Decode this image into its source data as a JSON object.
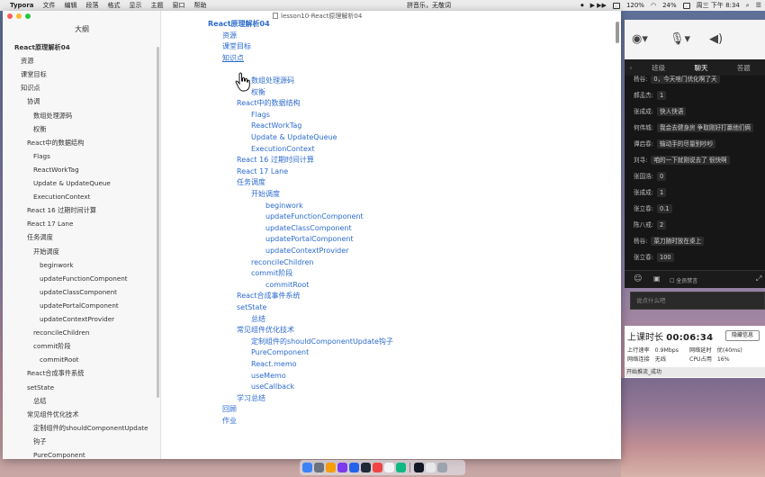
{
  "menubar": {
    "app": "Typora",
    "items": [
      "文件",
      "编辑",
      "段落",
      "格式",
      "显示",
      "主题",
      "窗口",
      "帮助"
    ],
    "banner": "拼音乐，无敬词",
    "zoom": "120%",
    "battery": "24%",
    "clock": "周三 下午 8:34"
  },
  "window": {
    "title": "lesson10-React原理解析04"
  },
  "sidebar": {
    "title": "大纲",
    "items": [
      {
        "label": "React原理解析04",
        "level": 0,
        "bold": true
      },
      {
        "label": "资源",
        "level": 1
      },
      {
        "label": "课堂目标",
        "level": 1
      },
      {
        "label": "知识点",
        "level": 1
      },
      {
        "label": "协调",
        "level": 2
      },
      {
        "label": "数组处理源码",
        "level": 3
      },
      {
        "label": "权衡",
        "level": 3
      },
      {
        "label": "React中的数据结构",
        "level": 2
      },
      {
        "label": "Flags",
        "level": 3
      },
      {
        "label": "ReactWorkTag",
        "level": 3
      },
      {
        "label": "Update & UpdateQueue",
        "level": 3
      },
      {
        "label": "ExecutionContext",
        "level": 3
      },
      {
        "label": "React 16 过期时间计算",
        "level": 2
      },
      {
        "label": "React 17 Lane",
        "level": 2
      },
      {
        "label": "任务调度",
        "level": 2
      },
      {
        "label": "开始调度",
        "level": 3
      },
      {
        "label": "beginwork",
        "level": 4
      },
      {
        "label": "updateFunctionComponent",
        "level": 4
      },
      {
        "label": "updateClassComponent",
        "level": 4
      },
      {
        "label": "updatePortalComponent",
        "level": 4
      },
      {
        "label": "updateContextProvider",
        "level": 4
      },
      {
        "label": "reconcileChildren",
        "level": 3
      },
      {
        "label": "commit阶段",
        "level": 3
      },
      {
        "label": "commitRoot",
        "level": 4
      },
      {
        "label": "React合成事件系统",
        "level": 2
      },
      {
        "label": "setState",
        "level": 2
      },
      {
        "label": "总结",
        "level": 3
      },
      {
        "label": "常见组件优化技术",
        "level": 2
      },
      {
        "label": "定制组件的shouldComponentUpdate",
        "level": 3
      },
      {
        "label": "钩子",
        "level": 3,
        "continuation": true
      },
      {
        "label": "PureComponent",
        "level": 3
      }
    ]
  },
  "document": {
    "toc": [
      {
        "label": "React原理解析04",
        "level": 0,
        "bold": true
      },
      {
        "label": "资源",
        "level": 1
      },
      {
        "label": "课堂目标",
        "level": 1
      },
      {
        "label": "知识点",
        "level": 1,
        "hover": true
      },
      {
        "label": "",
        "level": 2
      },
      {
        "label": "数组处理源码",
        "level": 3
      },
      {
        "label": "权衡",
        "level": 3
      },
      {
        "label": "React中的数据结构",
        "level": 2
      },
      {
        "label": "Flags",
        "level": 3
      },
      {
        "label": "ReactWorkTag",
        "level": 3
      },
      {
        "label": "Update & UpdateQueue",
        "level": 3
      },
      {
        "label": "ExecutionContext",
        "level": 3
      },
      {
        "label": "React 16 过期时间计算",
        "level": 2
      },
      {
        "label": "React 17 Lane",
        "level": 2
      },
      {
        "label": "任务调度",
        "level": 2
      },
      {
        "label": "开始调度",
        "level": 3
      },
      {
        "label": "beginwork",
        "level": 4
      },
      {
        "label": "updateFunctionComponent",
        "level": 4
      },
      {
        "label": "updateClassComponent",
        "level": 4
      },
      {
        "label": "updatePortalComponent",
        "level": 4
      },
      {
        "label": "updateContextProvider",
        "level": 4
      },
      {
        "label": "reconcileChildren",
        "level": 3
      },
      {
        "label": "commit阶段",
        "level": 3
      },
      {
        "label": "commitRoot",
        "level": 4
      },
      {
        "label": "React合成事件系统",
        "level": 2
      },
      {
        "label": "setState",
        "level": 2
      },
      {
        "label": "总结",
        "level": 3
      },
      {
        "label": "常见组件优化技术",
        "level": 2
      },
      {
        "label": "定制组件的shouldComponentUpdate钩子",
        "level": 3
      },
      {
        "label": "PureComponent",
        "level": 3
      },
      {
        "label": "React.memo",
        "level": 3
      },
      {
        "label": "useMemo",
        "level": 3
      },
      {
        "label": "useCallback",
        "level": 3
      },
      {
        "label": "学习总结",
        "level": 2
      },
      {
        "label": "回顾",
        "level": 1
      },
      {
        "label": "作业",
        "level": 1
      }
    ]
  },
  "classroom": {
    "tabs": [
      "班级",
      "聊天",
      "答题"
    ],
    "active_tab": "聊天",
    "messages": [
      {
        "name": "杨谷:",
        "text": "0，今天啥门优化啊了天"
      },
      {
        "name": "郝孟杰:",
        "text": "1"
      },
      {
        "name": "张成成:",
        "text": "快人快语"
      },
      {
        "name": "何伟城:",
        "text": "我会去健身房 争取刚好打赢他们俩"
      },
      {
        "name": "谭启春:",
        "text": "输动手的尽量别吵吵"
      },
      {
        "name": "刘寻:",
        "text": "咱的一下就刚说去了 很快啊"
      },
      {
        "name": "张国浩:",
        "text": "0"
      },
      {
        "name": "张成成:",
        "text": "1"
      },
      {
        "name": "张立春:",
        "text": "0.1"
      },
      {
        "name": "陈八戒:",
        "text": "2"
      },
      {
        "name": "杨谷:",
        "text": "菜刀随时放在桌上"
      },
      {
        "name": "张立春:",
        "text": "100"
      }
    ],
    "tools": {
      "checkbox_label": "全员禁言"
    },
    "input_placeholder": "说点什么吧",
    "duration_label": "上课时长",
    "duration": "00:06:34",
    "hide_label": "隐藏信息",
    "upload_label": "上行速率",
    "upload_value": "0.9Mbps",
    "latency_label": "网络延时",
    "latency_value": "优(40ms)",
    "net_label": "网络连接",
    "net_value": "无线",
    "cpu_label": "CPU占用",
    "cpu_value": "16%",
    "status": "开始推流_成功"
  }
}
